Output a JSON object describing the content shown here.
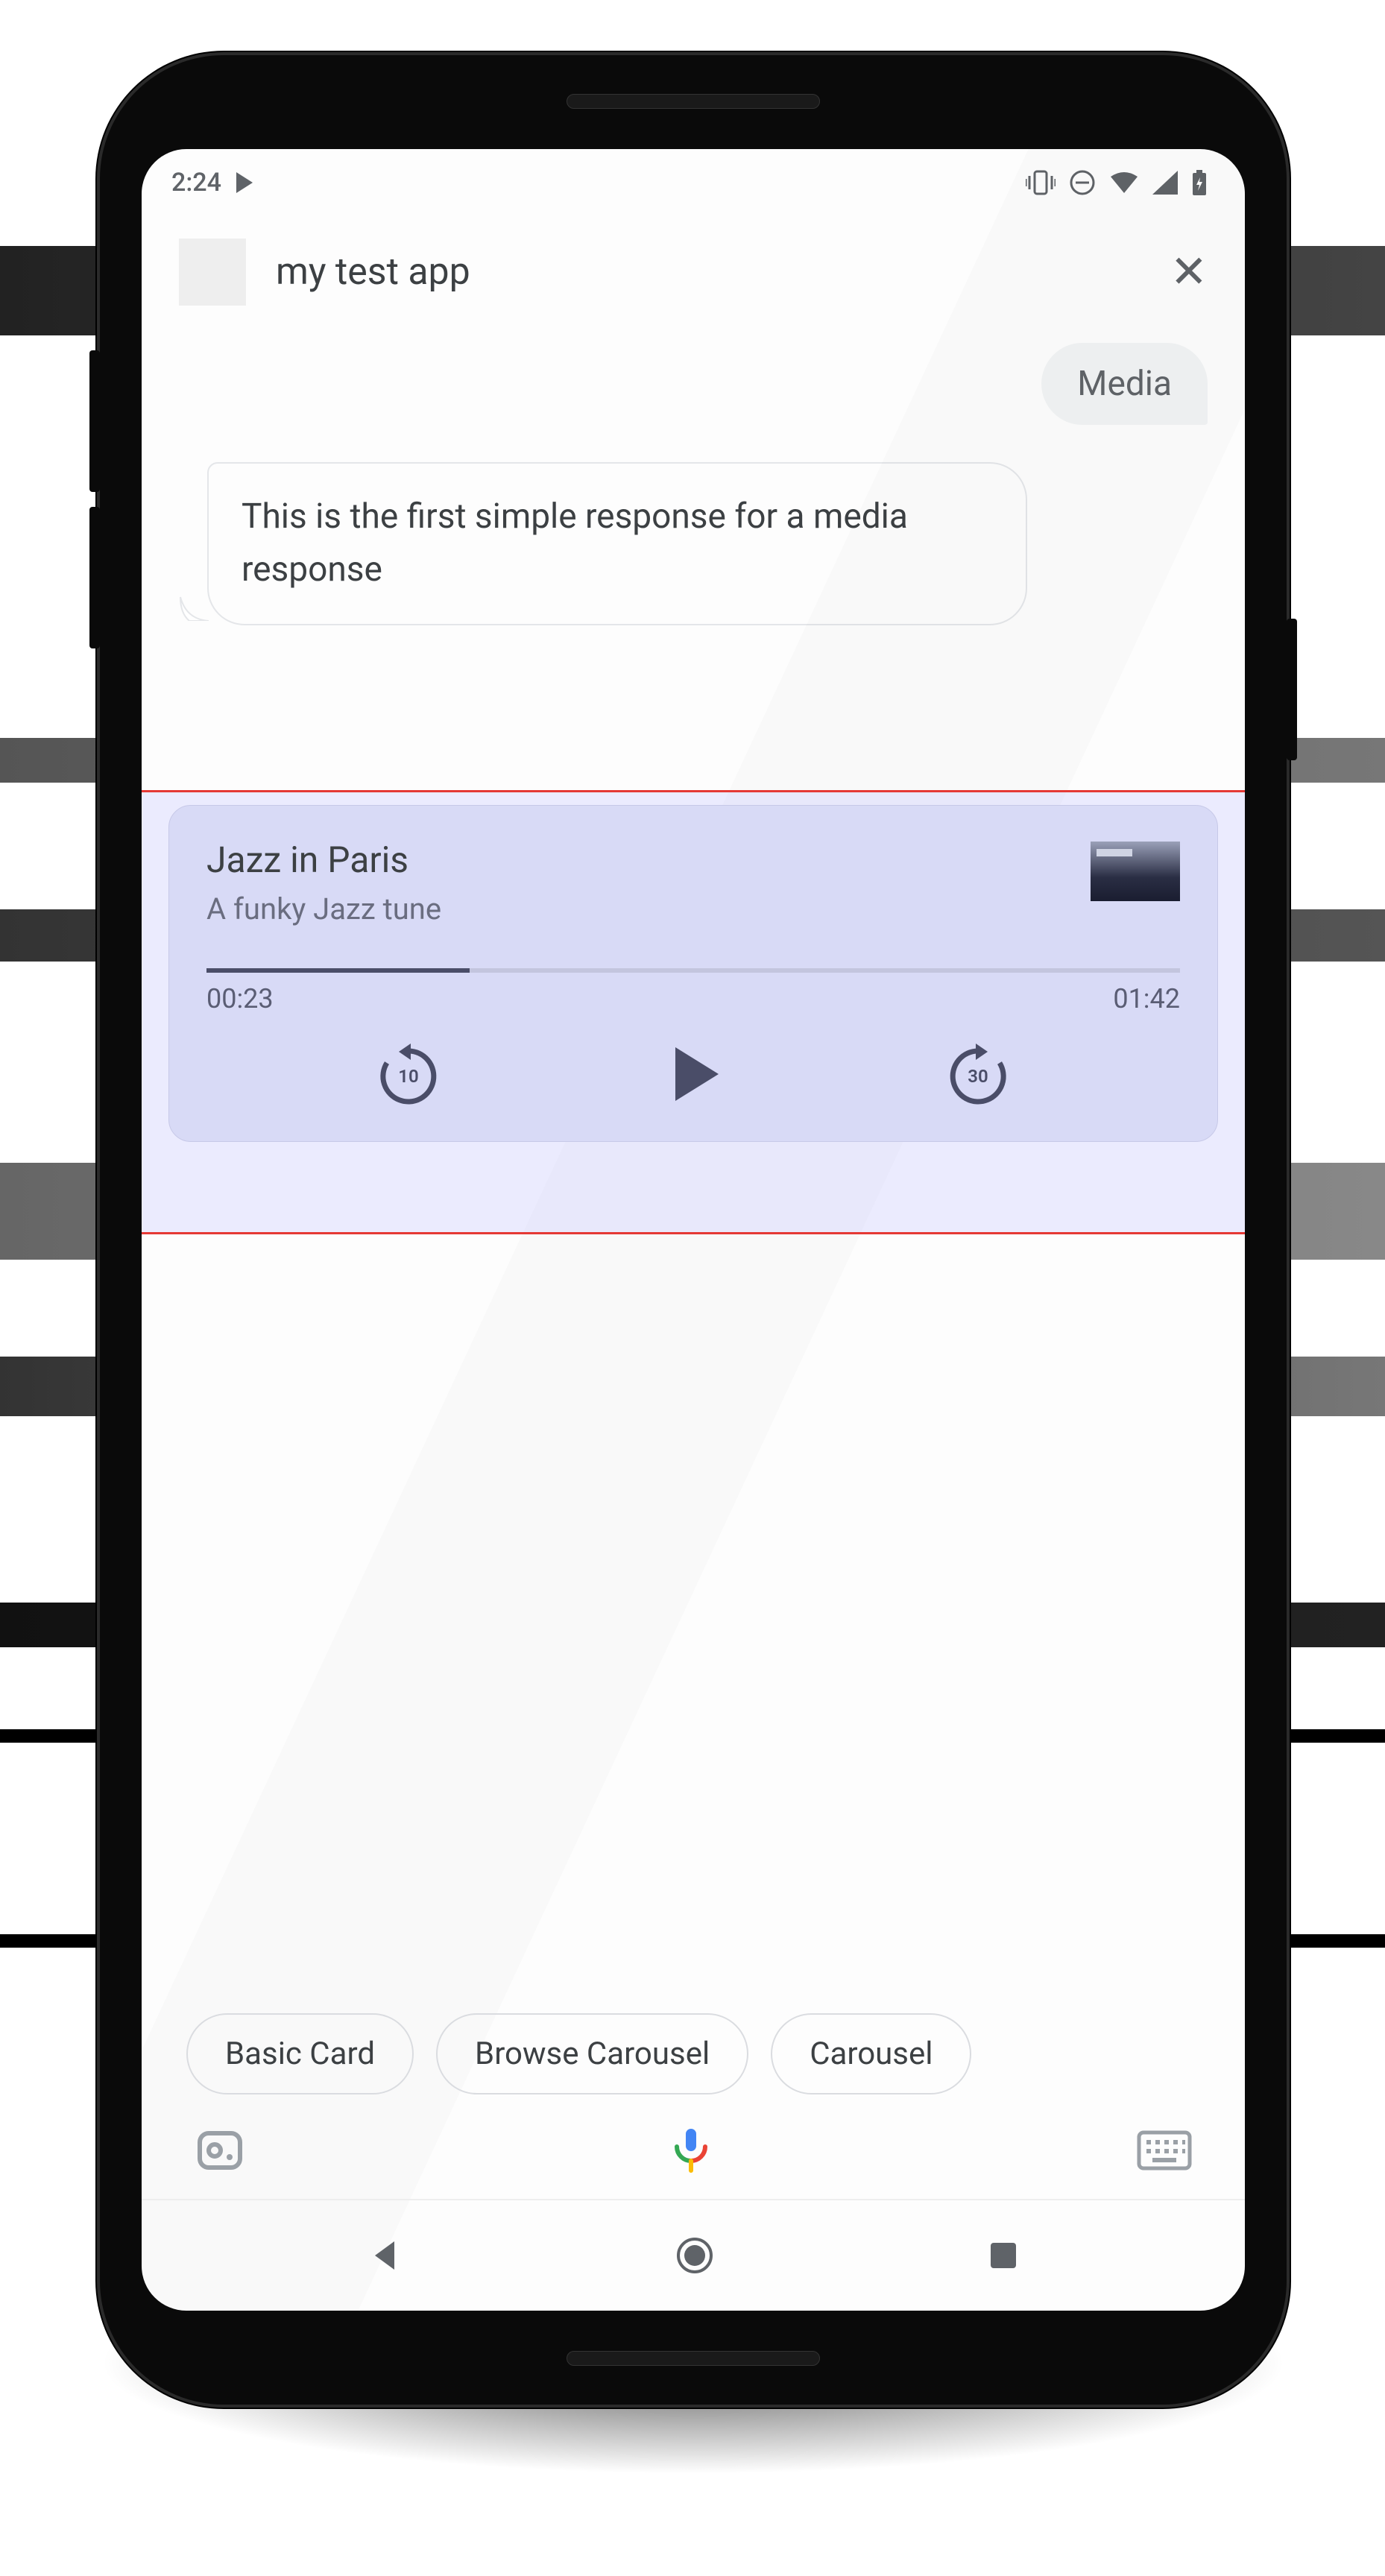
{
  "status": {
    "time": "2:24"
  },
  "header": {
    "app_name": "my test app"
  },
  "chat": {
    "user_msg": "Media",
    "bot_msg": "This is the first simple response for a media response"
  },
  "media": {
    "title": "Jazz in Paris",
    "subtitle": "A funky Jazz tune",
    "elapsed": "00:23",
    "duration": "01:42",
    "rewind_secs": "10",
    "forward_secs": "30",
    "progress_pct": 27
  },
  "suggestions": [
    "Basic Card",
    "Browse Carousel",
    "Carousel"
  ]
}
